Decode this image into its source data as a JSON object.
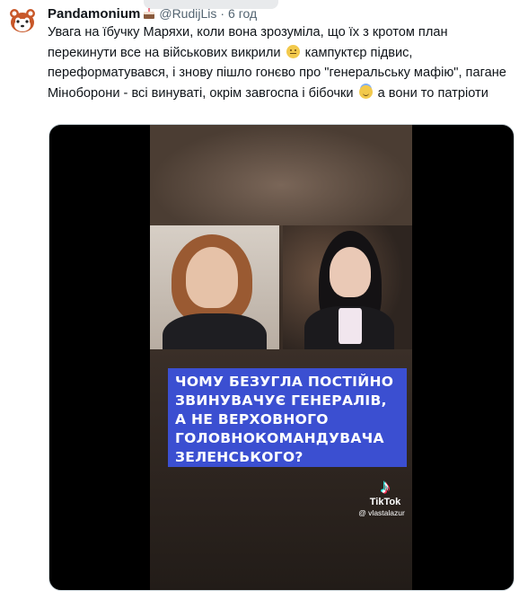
{
  "tweet": {
    "display_name": "Pandamonium",
    "handle": "@RudijLis",
    "separator": "·",
    "time": "6 год",
    "text_1": "Увага на їбучку Маряхи, коли вона зрозуміла, що їх з кротом план перекинути все на військових викрили",
    "text_2": "кампуктєр підвис, переформатувався, і знову пішло гонєво про \"генеральську мафію\", пагане Міноборони - всі винуваті, окрім завгоспа і бібочки",
    "text_3": "а вони то патріоти",
    "emoji_1": "neutral-face-emoji",
    "emoji_2": "smiling-face-with-halo-emoji",
    "badge_icon": "cake-emoji"
  },
  "video": {
    "caption_lines": [
      "ЧОМУ БЕЗУГЛА ПОСТІЙНО",
      "ЗВИНУВАЧУЄ ГЕНЕРАЛІВ,",
      "А НЕ ВЕРХОВНОГО",
      "ГОЛОВНОКОМАНДУВАЧА",
      "ЗЕЛЕНСЬКОГО?"
    ],
    "watermark_glyph": "♪",
    "watermark_label": "TikTok",
    "watermark_user": "@ vlastalazur",
    "caption_bg": "#3b4fd1"
  },
  "colors": {
    "text": "#0f1419",
    "secondary": "#536471"
  }
}
